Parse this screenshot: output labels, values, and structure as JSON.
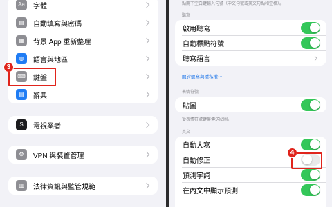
{
  "left": {
    "group1": [
      {
        "label": "字體",
        "icon": "font-icon",
        "glyph": "Aa",
        "color": "#8e8e93"
      },
      {
        "label": "自動填寫與密碼",
        "icon": "autofill-key-icon",
        "glyph": "▤",
        "color": "#8e8e93"
      },
      {
        "label": "背景 App 重新整理",
        "icon": "background-refresh-icon",
        "glyph": "▦",
        "color": "#8e8e93"
      },
      {
        "label": "語言與地區",
        "icon": "globe-icon",
        "glyph": "◍",
        "color": "#1f7cf4"
      },
      {
        "label": "鍵盤",
        "icon": "keyboard-icon",
        "glyph": "⌨",
        "color": "#8e8e93"
      },
      {
        "label": "辭典",
        "icon": "dictionary-icon",
        "glyph": "▤",
        "color": "#1f7cf4"
      }
    ],
    "group2": [
      {
        "label": "電視業者",
        "icon": "tv-provider-icon",
        "glyph": "S",
        "color": "#1c1c1e"
      }
    ],
    "group3": [
      {
        "label": "VPN 與裝置管理",
        "icon": "vpn-icon",
        "glyph": "⚙",
        "color": "#8e8e93"
      }
    ],
    "group4": [
      {
        "label": "法律資訊與監管規範",
        "icon": "legal-icon",
        "glyph": "▥",
        "color": "#8e8e93"
      }
    ],
    "badge": "3"
  },
  "right": {
    "top_note": "點兩下空白鍵輸入句號（中文句號或英文句點和空格）。",
    "dictation_header": "聽寫",
    "dictation_rows": [
      {
        "label": "啟用聽寫",
        "toggle": "on"
      },
      {
        "label": "自動標點符號",
        "toggle": "on"
      },
      {
        "label": "聽寫語言",
        "toggle": "chevron"
      }
    ],
    "dictation_link": "關於聽寫與隱私權⋯",
    "emoji_header": "表情符號",
    "emoji_rows": [
      {
        "label": "貼圖",
        "toggle": "on"
      }
    ],
    "emoji_note": "從表情符號鍵盤傳送貼圖。",
    "english_header": "英文",
    "english_rows": [
      {
        "label": "自動大寫",
        "toggle": "on"
      },
      {
        "label": "自動修正",
        "toggle": "off"
      },
      {
        "label": "預測字詞",
        "toggle": "on"
      },
      {
        "label": "在內文中顯示預測",
        "toggle": "on"
      }
    ],
    "badge": "4"
  },
  "colors": {
    "accent_red": "#e0241c",
    "toggle_green": "#34c759",
    "link_blue": "#1a73e8"
  }
}
